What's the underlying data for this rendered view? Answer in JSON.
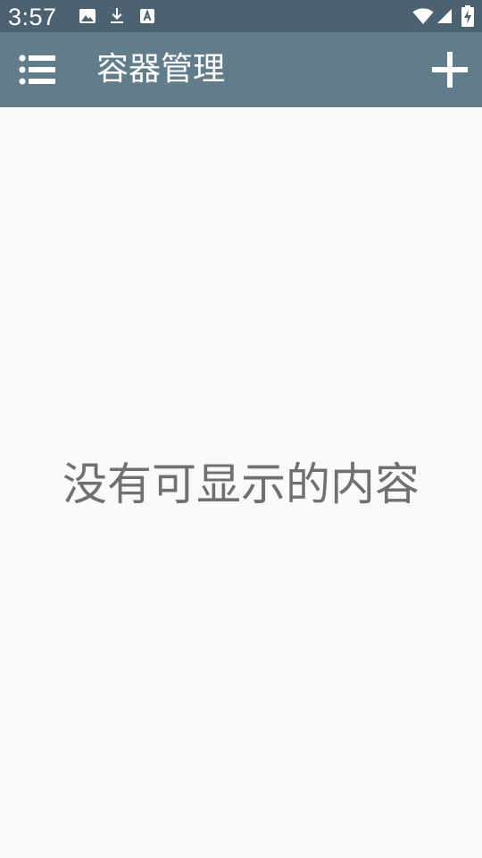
{
  "status_bar": {
    "time": "3:57",
    "left_icons": [
      "image-icon",
      "download-icon",
      "font-icon"
    ],
    "right_icons": [
      "wifi-icon",
      "signal-icon",
      "battery-charging-icon"
    ]
  },
  "app_bar": {
    "title": "容器管理",
    "menu_icon": "list-menu-icon",
    "add_icon": "plus-icon"
  },
  "main": {
    "empty_message": "没有可显示的内容"
  },
  "colors": {
    "status_bar_bg": "#4d6270",
    "app_bar_bg": "#617d8b",
    "content_bg": "#fafafa",
    "empty_text": "#707070"
  }
}
